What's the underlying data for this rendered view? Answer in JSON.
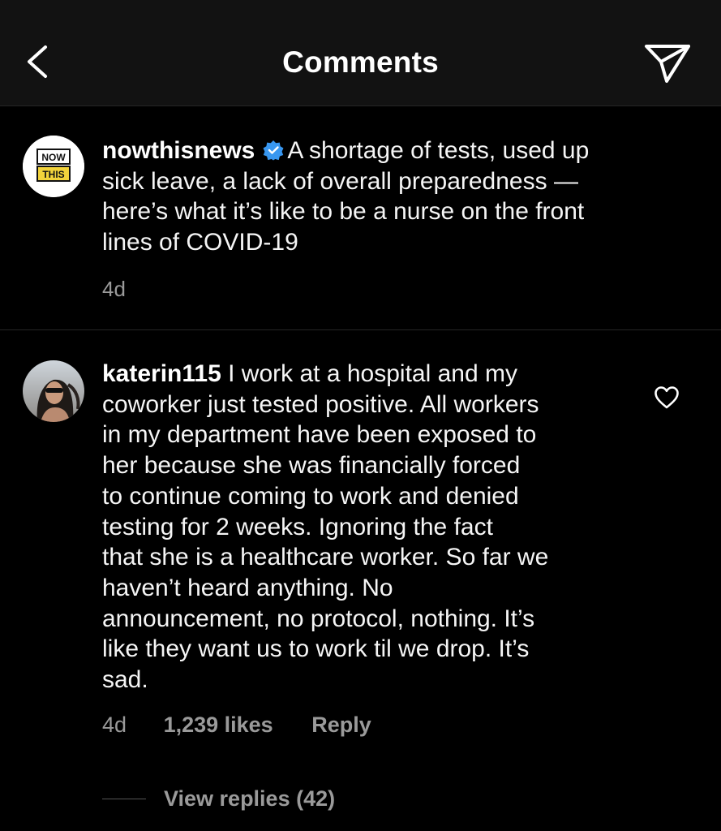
{
  "header": {
    "title": "Comments",
    "back_icon": "chevron-left-icon",
    "send_icon": "send-icon"
  },
  "caption": {
    "username": "nowthisnews",
    "verified_icon": "verified-badge-icon",
    "avatar": {
      "line1": "NOW",
      "line2": "THIS"
    },
    "lines": [
      "A shortage of tests, used up",
      "sick leave, a lack of overall preparedness —",
      "here’s what it’s like to be a nurse on the front",
      "lines of COVID-19"
    ],
    "time": "4d"
  },
  "comment": {
    "username": "katerin115",
    "lines": [
      "I work at a hospital and my",
      "coworker just tested positive. All workers",
      "in my department have been exposed to",
      "her because she was financially forced",
      "to continue coming to work and denied",
      "testing for 2 weeks. Ignoring the fact",
      "that she is a healthcare worker. So far we",
      "haven’t heard anything. No",
      "announcement, no protocol, nothing. It’s",
      "like they want us to work til we drop. It’s",
      "sad."
    ],
    "time": "4d",
    "likes": "1,239 likes",
    "reply_label": "Reply",
    "view_replies": "View replies (42)",
    "like_icon": "heart-outline-icon"
  },
  "colors": {
    "background": "#000000",
    "header": "#121212",
    "secondary_text": "#9a9a9a",
    "verified": "#3897f0"
  }
}
